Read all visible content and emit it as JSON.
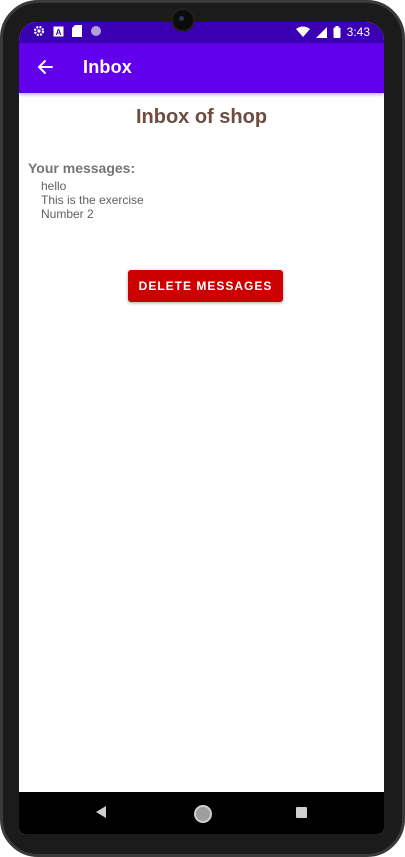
{
  "status_bar": {
    "time": "3:43",
    "icons_left": [
      "settings-icon",
      "a-icon",
      "sd-card-icon",
      "circle-icon"
    ],
    "icons_right": [
      "wifi-icon",
      "signal-icon",
      "battery-icon"
    ]
  },
  "app_bar": {
    "title": "Inbox",
    "back_icon": "arrow-back-icon"
  },
  "content": {
    "page_title": "Inbox of shop",
    "messages_label": "Your messages:",
    "messages": [
      "hello",
      "This is the exercise",
      "Number 2"
    ],
    "delete_button": "DELETE MESSAGES"
  },
  "nav_bar": {
    "buttons": [
      "back-icon",
      "home-icon",
      "recents-icon"
    ]
  },
  "colors": {
    "status_bar": "#3b00b3",
    "app_bar": "#6200ee",
    "title": "#6d4c41",
    "delete_button": "#cc0000"
  }
}
